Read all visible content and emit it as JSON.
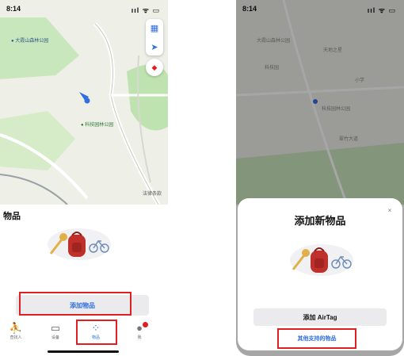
{
  "left": {
    "status_time": "8:14",
    "status_icons": "ııl ᯤ ▭",
    "poi_top": "大霞山森林公园",
    "poi_park": "科技园林公园",
    "legal": "法律条款",
    "section_title": "物品",
    "add_item_label": "添加物品",
    "tabs": [
      {
        "label": "查找人",
        "icon": "people-icon",
        "glyph": "⛹"
      },
      {
        "label": "设备",
        "icon": "devices-icon",
        "glyph": "▭"
      },
      {
        "label": "物品",
        "icon": "items-icon",
        "glyph": "⁘"
      },
      {
        "label": "我",
        "icon": "me-icon",
        "glyph": "●"
      }
    ]
  },
  "right": {
    "status_time": "8:14",
    "status_icons": "ııl ᯤ ▭",
    "sheet_title": "添加新物品",
    "close_glyph": "×",
    "add_airtag_label": "添加 AirTag",
    "other_items_label": "其他支持的物品",
    "bg_texts": [
      "大霞山森林公园",
      "天地之星",
      "科技园",
      "小学",
      "科技园林公园",
      "翠竹大道"
    ]
  },
  "colors": {
    "accent": "#2f6fe0",
    "highlight": "#e02020",
    "map_green": "#b7e0a8"
  }
}
